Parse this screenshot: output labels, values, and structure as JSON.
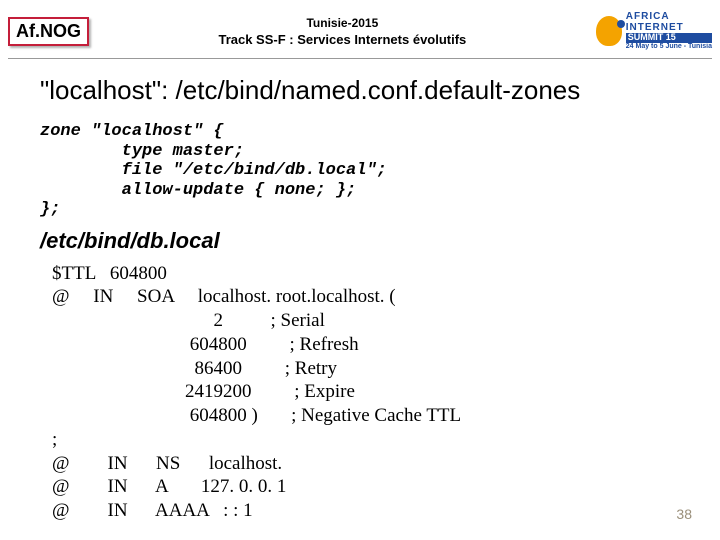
{
  "header": {
    "logo_left": "Af.NOG",
    "top_small": "Tunisie-2015",
    "subtitle": "Track SS-F : Services Internets évolutifs",
    "summit_line1": "AFRICA",
    "summit_line2": "INTERNET",
    "summit_line3": "SUMMIT 15",
    "summit_dates": "24 May to 5 June - Tunisia"
  },
  "title_prefix": "\"localhost",
  "title_quote_colon": "\": ",
  "title_path": "/etc/bind/named.conf.default-zones",
  "zone_block": "zone \"localhost\" {\n        type master;\n        file \"/etc/bind/db.local\";\n        allow-update { none; };\n};",
  "subheading": "/etc/bind/db.local",
  "db_local": "$TTL   604800\n@     IN     SOA     localhost. root.localhost. (\n                                  2          ; Serial\n                             604800         ; Refresh\n                              86400         ; Retry\n                            2419200         ; Expire\n                             604800 )       ; Negative Cache TTL\n;\n@        IN      NS      localhost.\n@        IN      A       127. 0. 0. 1\n@        IN      AAAA   : : 1",
  "page_number": "38"
}
